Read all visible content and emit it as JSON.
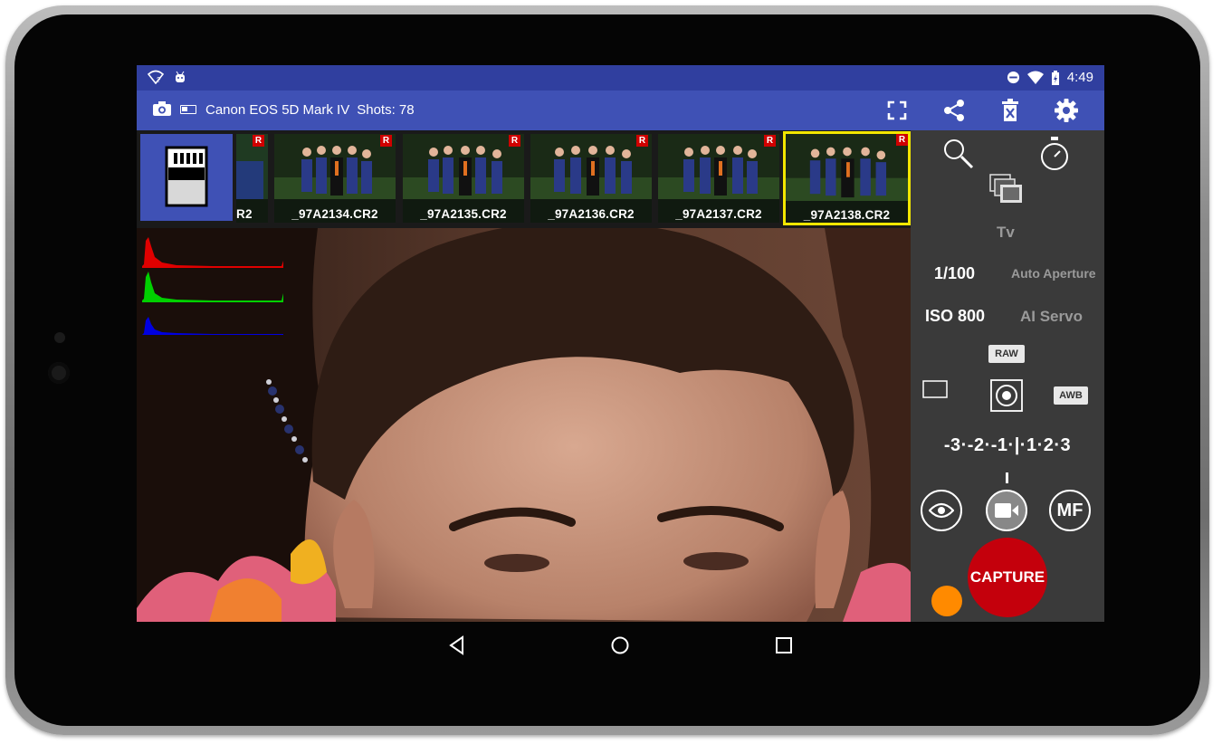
{
  "status_bar": {
    "wifi_icon": "wifi-question-icon",
    "android_icon": "android-debug-icon",
    "time": "4:49"
  },
  "app_bar": {
    "camera_model": "Canon EOS 5D Mark IV",
    "shots_label": "Shots: 78"
  },
  "filmstrip": {
    "items": [
      {
        "name": "R2",
        "badge": "R"
      },
      {
        "name": "_97A2134.CR2",
        "badge": "R"
      },
      {
        "name": "_97A2135.CR2",
        "badge": "R"
      },
      {
        "name": "_97A2136.CR2",
        "badge": "R"
      },
      {
        "name": "_97A2137.CR2",
        "badge": "R"
      },
      {
        "name": "_97A2138.CR2",
        "badge": "R",
        "selected": true
      }
    ]
  },
  "controls": {
    "mode": "Tv",
    "shutter": "1/100",
    "aperture": "Auto Aperture",
    "iso": "ISO 800",
    "af_mode": "AI Servo",
    "quality": "RAW",
    "white_balance": "AWB",
    "exposure_scale": "-3·-2·-1·|·1·2·3",
    "capture_label": "CAPTURE",
    "mf_label": "MF"
  },
  "colors": {
    "status_bar": "#303f9f",
    "app_bar": "#3f51b5",
    "panel": "#3a3a3a",
    "capture": "#c4000c",
    "selected_border": "#f2e600",
    "indicator": "#ff8a00"
  }
}
